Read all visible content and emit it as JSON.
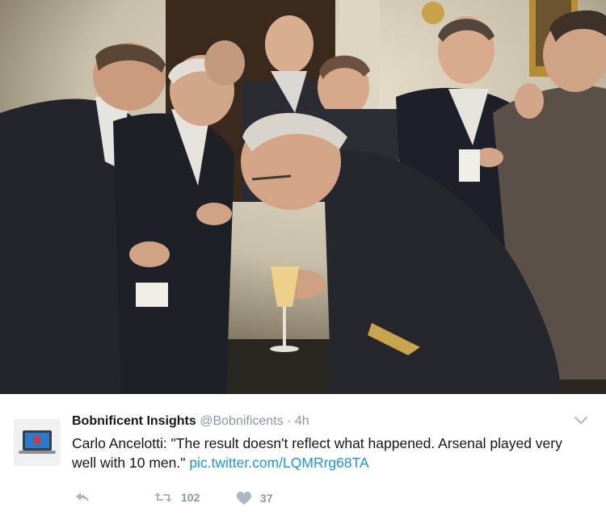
{
  "tweet": {
    "display_name": "Bobnificent Insights",
    "handle": "@Bobnificents",
    "separator": "·",
    "time": "4h",
    "text": "Carlo Ancelotti: \"The result doesn't reflect what happened. Arsenal played very well with 10 men.\"",
    "link_text": "pic.twitter.com/LQMRrg68TA"
  },
  "actions": {
    "reply_icon": "reply-icon",
    "retweet_icon": "retweet-icon",
    "retweet_count": "102",
    "like_icon": "heart-icon",
    "like_count": "37",
    "more_icon": "chevron-down-icon"
  },
  "colors": {
    "text": "#14171a",
    "muted": "#8899a6",
    "link": "#1b95e0"
  }
}
